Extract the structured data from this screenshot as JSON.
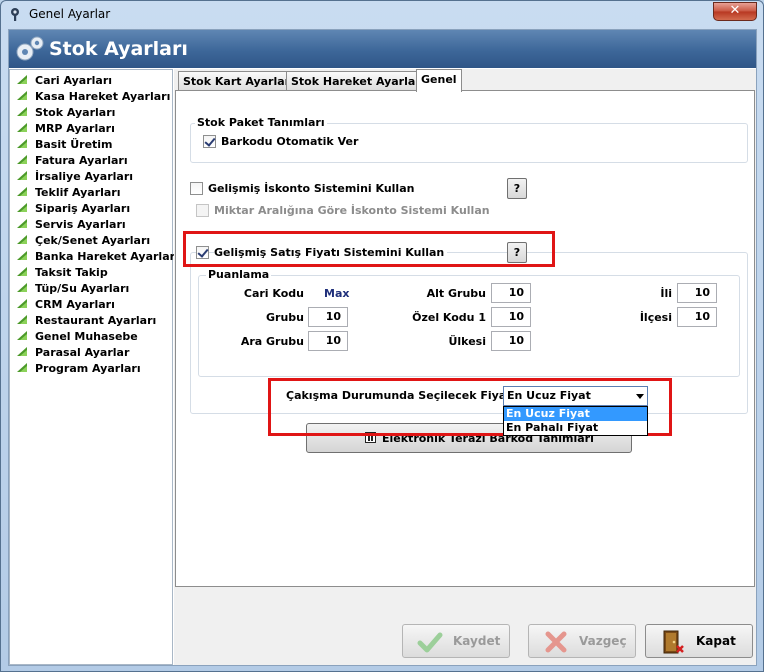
{
  "window": {
    "title": "Genel Ayarlar",
    "close_label": "✕"
  },
  "header": {
    "title": "Stok Ayarları"
  },
  "sidebar": {
    "items": [
      "Cari Ayarları",
      "Kasa Hareket Ayarları",
      "Stok Ayarları",
      "MRP Ayarları",
      "Basit Üretim",
      "Fatura Ayarları",
      "İrsaliye Ayarları",
      "Teklif Ayarları",
      "Sipariş Ayarları",
      "Servis Ayarları",
      "Çek/Senet Ayarları",
      "Banka Hareket Ayarları",
      "Taksit Takip",
      "Tüp/Su Ayarları",
      "CRM Ayarları",
      "Restaurant Ayarları",
      "Genel Muhasebe",
      "Parasal Ayarlar",
      "Program Ayarları"
    ]
  },
  "tabs": [
    "Stok Kart Ayarları",
    "Stok Hareket Ayarları",
    "Genel"
  ],
  "active_tab": "Genel",
  "stok_paket": {
    "group_title": "Stok Paket Tanımları",
    "barkod_label": "Barkodu Otomatik Ver",
    "barkod_checked": true
  },
  "iskonto": {
    "label": "Gelişmiş İskonto Sistemini Kullan",
    "checked": false,
    "miktar_label": "Miktar Aralığına Göre İskonto Sistemi Kullan",
    "miktar_enabled": false,
    "help": "?"
  },
  "satis_fiyati": {
    "label": "Gelişmiş Satış Fiyatı Sistemini Kullan",
    "checked": true,
    "help": "?"
  },
  "puanlama": {
    "title": "Puanlama",
    "cari_kodu_label": "Cari Kodu",
    "cari_kodu_value": "Max",
    "grubu_label": "Grubu",
    "grubu_value": "10",
    "ara_grubu_label": "Ara Grubu",
    "ara_grubu_value": "10",
    "alt_grubu_label": "Alt Grubu",
    "alt_grubu_value": "10",
    "ozel_kodu_label": "Özel Kodu 1",
    "ozel_kodu_value": "10",
    "ulkesi_label": "Ülkesi",
    "ulkesi_value": "10",
    "ili_label": "İli",
    "ili_value": "10",
    "ilcesi_label": "İlçesi",
    "ilcesi_value": "10"
  },
  "cakisma": {
    "label": "Çakışma Durumunda Seçilecek Fiyat",
    "selected": "En Ucuz Fiyat",
    "options": [
      "En Ucuz Fiyat",
      "En Pahalı Fiyat"
    ]
  },
  "terazi_button": "Elektronik Terazi Barkod Tanımları",
  "footer": {
    "save": "Kaydet",
    "cancel": "Vazgeç",
    "close": "Kapat"
  },
  "colors": {
    "highlight_red": "#e01515",
    "header_blue": "#3d6799",
    "selection_blue": "#3399ff"
  }
}
